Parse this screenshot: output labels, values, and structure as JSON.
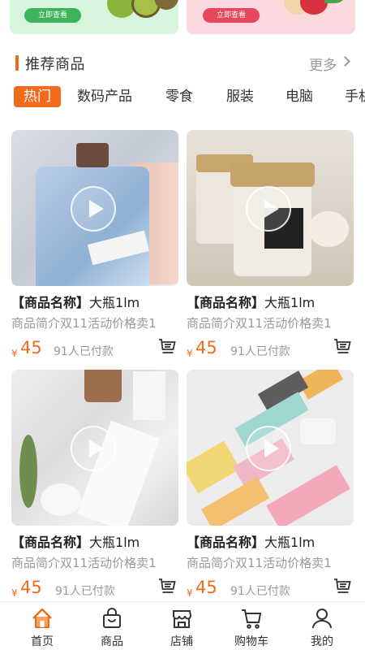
{
  "banners": [
    {
      "button_label": "立即查看",
      "color": "#3cb35b",
      "background": "#d6f5dc"
    },
    {
      "button_label": "立即查看",
      "color": "#e5475d",
      "background": "#fcd9df"
    }
  ],
  "section": {
    "title": "推荐商品",
    "more_label": "更多",
    "accent": "#f26b1d"
  },
  "tabs": [
    {
      "label": "热门",
      "active": true
    },
    {
      "label": "数码产品",
      "active": false
    },
    {
      "label": "零食",
      "active": false
    },
    {
      "label": "服装",
      "active": false
    },
    {
      "label": "电脑",
      "active": false
    },
    {
      "label": "手机",
      "active": false
    }
  ],
  "products": [
    {
      "title_tag": "【商品名称】",
      "title_text": "大瓶1lm",
      "desc": "商品简介双11活动价格卖1",
      "price_symbol": "¥",
      "price": "45",
      "sold": "91人已付款",
      "image": "gin-bottle"
    },
    {
      "title_tag": "【商品名称】",
      "title_text": "大瓶1lm",
      "desc": "商品简介双11活动价格卖1",
      "price_symbol": "¥",
      "price": "45",
      "sold": "91人已付款",
      "image": "jars"
    },
    {
      "title_tag": "【商品名称】",
      "title_text": "大瓶1lm",
      "desc": "商品简介双11活动价格卖1",
      "price_symbol": "¥",
      "price": "45",
      "sold": "91人已付款",
      "image": "cosmetics-marble"
    },
    {
      "title_tag": "【商品名称】",
      "title_text": "大瓶1lm",
      "desc": "商品简介双11活动价格卖1",
      "price_symbol": "¥",
      "price": "45",
      "sold": "91人已付款",
      "image": "pastel-boxes"
    }
  ],
  "nav": [
    {
      "label": "首页",
      "icon": "home-icon",
      "active": true
    },
    {
      "label": "商品",
      "icon": "bag-icon",
      "active": false
    },
    {
      "label": "店铺",
      "icon": "store-icon",
      "active": false
    },
    {
      "label": "购物车",
      "icon": "cart-icon",
      "active": false
    },
    {
      "label": "我的",
      "icon": "user-icon",
      "active": false
    }
  ]
}
